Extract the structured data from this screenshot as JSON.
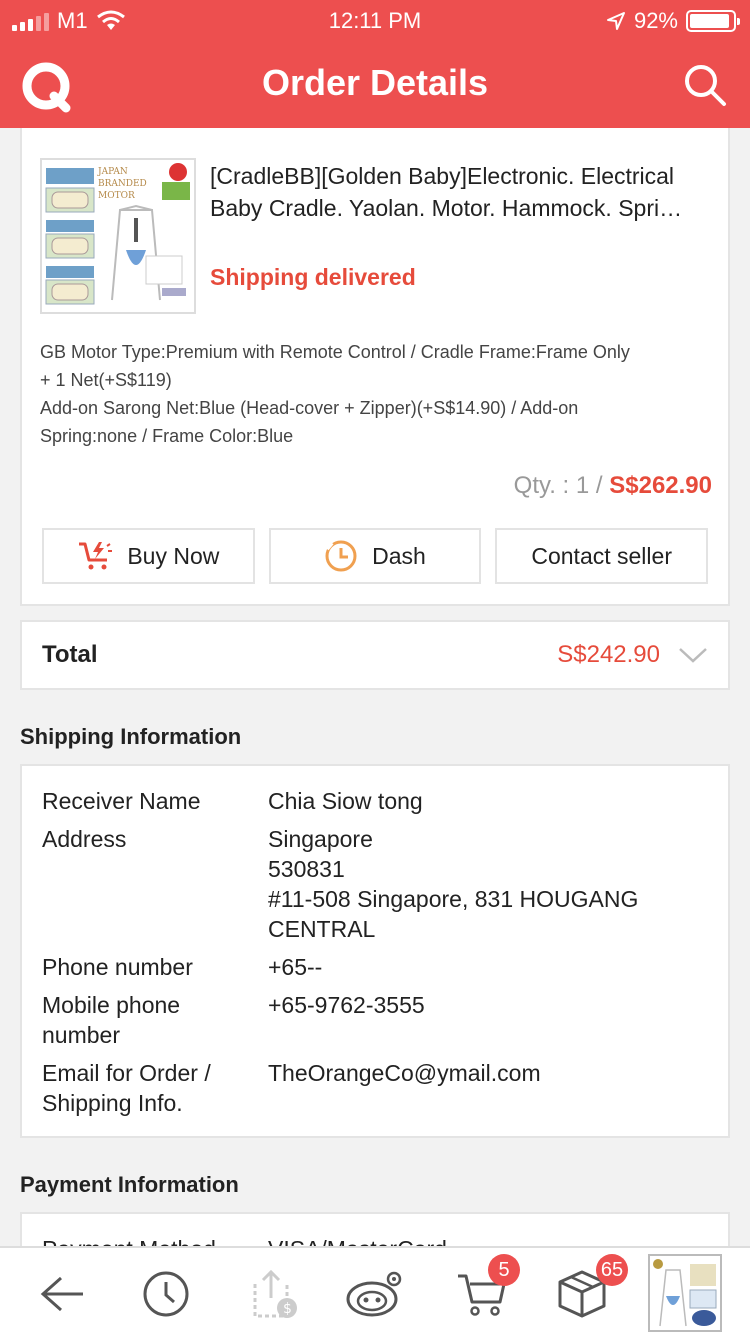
{
  "status_bar": {
    "carrier": "M1",
    "time": "12:11 PM",
    "battery": "92%",
    "battery_level": 0.92
  },
  "header": {
    "title": "Order Details"
  },
  "product": {
    "title_line1": "[CradleBB][Golden Baby]Electronic. Electrical",
    "title_line2": "Baby Cradle. Yaolan. Motor. Hammock. Spri…",
    "status": "Shipping delivered",
    "options_line1": "GB Motor Type:Premium with Remote Control / Cradle Frame:Frame Only",
    "options_line2": "+ 1 Net(+S$119)",
    "options_line3": "Add-on Sarong Net:Blue (Head-cover + Zipper)(+S$14.90) / Add-on",
    "options_line4": "Spring:none / Frame Color:Blue",
    "qty_label": "Qty. : 1 / ",
    "price": "S$262.90",
    "image_text": {
      "line1": "JAPAN",
      "line2": "BRANDED",
      "line3": "MOTOR"
    }
  },
  "actions": {
    "buy_now": "Buy Now",
    "dash": "Dash",
    "contact_seller": "Contact seller"
  },
  "total": {
    "label": "Total",
    "value": "S$242.90"
  },
  "shipping": {
    "section_title": "Shipping Information",
    "receiver_label": "Receiver Name",
    "receiver_value": "Chia Siow tong",
    "address_label": "Address",
    "address_line1": "Singapore",
    "address_line2": "530831",
    "address_line3": "#11-508 Singapore, 831 HOUGANG",
    "address_line4": "CENTRAL",
    "phone_label": "Phone number",
    "phone_value": "+65--",
    "mobile_label_line1": "Mobile phone",
    "mobile_label_line2": "number",
    "mobile_value": "+65-9762-3555",
    "email_label_line1": "Email for Order /",
    "email_label_line2": "Shipping Info.",
    "email_value": "TheOrangeCo@ymail.com"
  },
  "payment": {
    "section_title": "Payment Information",
    "method_label": "Payment Method",
    "method_value": "VISA/MasterCard"
  },
  "tab_bar": {
    "cart_badge": "5",
    "box_badge": "65"
  },
  "colors": {
    "brand": "#ed4f4f",
    "price": "#e64b3b"
  }
}
